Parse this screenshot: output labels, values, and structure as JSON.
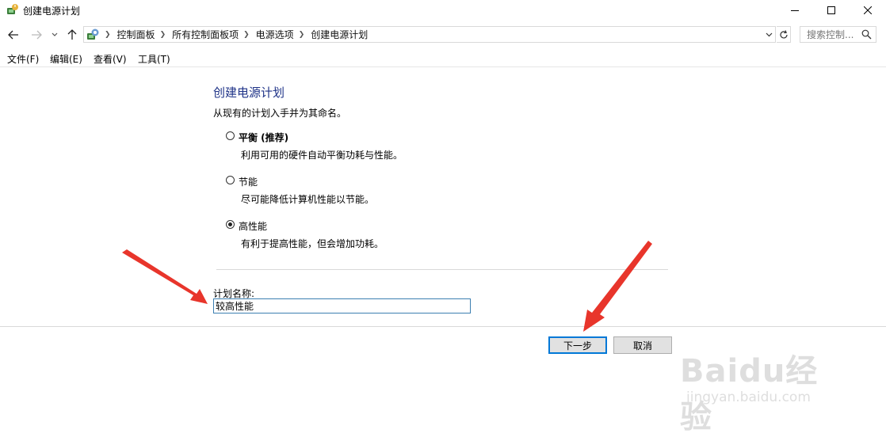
{
  "window": {
    "title": "创建电源计划",
    "minimize_icon": "minimize-icon",
    "maximize_icon": "maximize-icon",
    "close_icon": "close-icon"
  },
  "navigation": {
    "breadcrumbs": [
      "控制面板",
      "所有控制面板项",
      "电源选项",
      "创建电源计划"
    ],
    "search_placeholder": "搜索控制..."
  },
  "menu": [
    "文件(F)",
    "编辑(E)",
    "查看(V)",
    "工具(T)"
  ],
  "main": {
    "heading": "创建电源计划",
    "subtitle": "从现有的计划入手并为其命名。",
    "options": [
      {
        "title": "平衡 (推荐)",
        "description": "利用可用的硬件自动平衡功耗与性能。",
        "selected": false
      },
      {
        "title": "节能",
        "description": "尽可能降低计算机性能以节能。",
        "selected": false
      },
      {
        "title": "高性能",
        "description": "有利于提高性能，但会增加功耗。",
        "selected": true
      }
    ],
    "plan_name_label": "计划名称:",
    "plan_name_value": "较高性能"
  },
  "buttons": {
    "next": "下一步",
    "cancel": "取消"
  },
  "colors": {
    "heading": "#1e3287",
    "focus_border": "#0078d7",
    "annotation_arrow": "#e8352b"
  },
  "watermark": {
    "logo": "Baidu经验",
    "url": "jingyan.baidu.com"
  }
}
